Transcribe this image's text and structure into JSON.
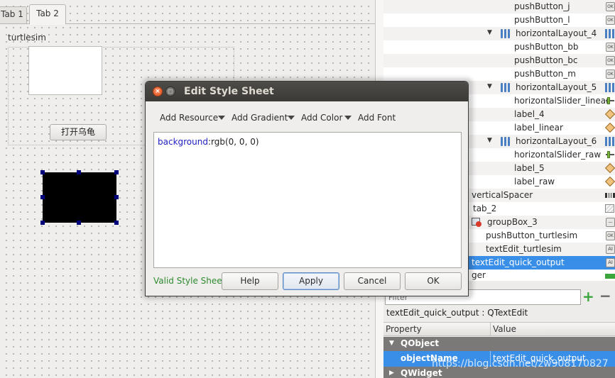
{
  "designer": {
    "tabs": [
      {
        "label": "Tab 1",
        "active": false
      },
      {
        "label": "Tab 2",
        "active": true
      }
    ],
    "group_title": "turtlesim",
    "open_button": "打开乌龟"
  },
  "object_tree": {
    "rows": [
      {
        "label": "pushButton_j",
        "icon": "push-button-icon"
      },
      {
        "label": "pushButton_l",
        "icon": "push-button-icon"
      },
      {
        "label": "horizontalLayout_4",
        "icon": "horizontal-layout-icon",
        "expanded": true
      },
      {
        "label": "pushButton_bb",
        "icon": "push-button-icon"
      },
      {
        "label": "pushButton_bc",
        "icon": "push-button-icon"
      },
      {
        "label": "pushButton_m",
        "icon": "push-button-icon"
      },
      {
        "label": "horizontalLayout_5",
        "icon": "horizontal-layout-icon",
        "expanded": true
      },
      {
        "label": "horizontalSlider_linear",
        "icon": "slider-icon"
      },
      {
        "label": "label_4",
        "icon": "label-icon"
      },
      {
        "label": "label_linear",
        "icon": "label-icon"
      },
      {
        "label": "horizontalLayout_6",
        "icon": "horizontal-layout-icon",
        "expanded": true
      },
      {
        "label": "horizontalSlider_raw",
        "icon": "slider-icon"
      },
      {
        "label": "label_5",
        "icon": "label-icon"
      },
      {
        "label": "label_raw",
        "icon": "label-icon"
      },
      {
        "label": "verticalSpacer",
        "icon": "spacer-icon"
      },
      {
        "label": "tab_2",
        "icon": "widget-icon"
      },
      {
        "label": "groupBox_3",
        "icon": "group-box-icon"
      },
      {
        "label": "pushButton_turtlesim",
        "icon": "push-button-icon"
      },
      {
        "label": "textEdit_turtlesim",
        "icon": "text-edit-icon"
      },
      {
        "label": "textEdit_quick_output",
        "icon": "text-edit-icon",
        "selected": true
      },
      {
        "label": "ger",
        "icon": "spacer-icon"
      }
    ]
  },
  "filter": {
    "placeholder": "Filter"
  },
  "property_editor": {
    "object_class": "textEdit_quick_output : QTextEdit",
    "col_property": "Property",
    "col_value": "Value",
    "group_qobject": "QObject",
    "object_name_key": "objectName",
    "object_name_value": "textEdit_quick_output",
    "group_qwidget": "QWidget"
  },
  "dialog": {
    "title": "Edit Style Sheet",
    "menus": [
      "Add Resource",
      "Add Gradient",
      "Add Color",
      "Add Font"
    ],
    "editor_property": "background",
    "editor_value": ":rgb(0, 0, 0)",
    "status": "Valid Style Sheet",
    "buttons": {
      "help": "Help",
      "apply": "Apply",
      "cancel": "Cancel",
      "ok": "OK"
    }
  },
  "watermark": "https://blog.csdn.net/zw908170827",
  "colors": {
    "selection": "#398ee7",
    "valid": "#2e8b2e",
    "titlebar": "#3b3a37"
  }
}
